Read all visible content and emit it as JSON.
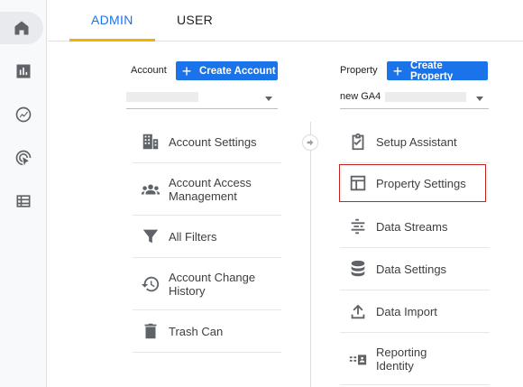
{
  "nav": {
    "rail": [
      "home-icon",
      "reports-icon",
      "explore-icon",
      "advertising-icon",
      "configure-icon"
    ]
  },
  "tabs": [
    {
      "label": "ADMIN",
      "active": true
    },
    {
      "label": "USER",
      "active": false
    }
  ],
  "account": {
    "label": "Account",
    "create_label": "Create Account",
    "selected_value": "",
    "items": [
      {
        "label": "Account Settings",
        "icon": "building-icon"
      },
      {
        "label": "Account Access Management",
        "icon": "people-icon"
      },
      {
        "label": "All Filters",
        "icon": "filter-icon"
      },
      {
        "label": "Account Change History",
        "icon": "history-icon"
      },
      {
        "label": "Trash Can",
        "icon": "trash-icon"
      }
    ]
  },
  "property": {
    "label": "Property",
    "create_label": "Create Property",
    "selected_value": "new GA4",
    "items": [
      {
        "label": "Setup Assistant",
        "icon": "checklist-icon"
      },
      {
        "label": "Property Settings",
        "icon": "layout-icon",
        "highlighted": true
      },
      {
        "label": "Data Streams",
        "icon": "streams-icon"
      },
      {
        "label": "Data Settings",
        "icon": "database-icon"
      },
      {
        "label": "Data Import",
        "icon": "upload-icon"
      },
      {
        "label": "Reporting Identity",
        "icon": "reporting-identity-icon"
      }
    ]
  },
  "colors": {
    "accent": "#1a73e8",
    "tab_underline": "#f0b400",
    "highlight_border": "#c5221f"
  }
}
